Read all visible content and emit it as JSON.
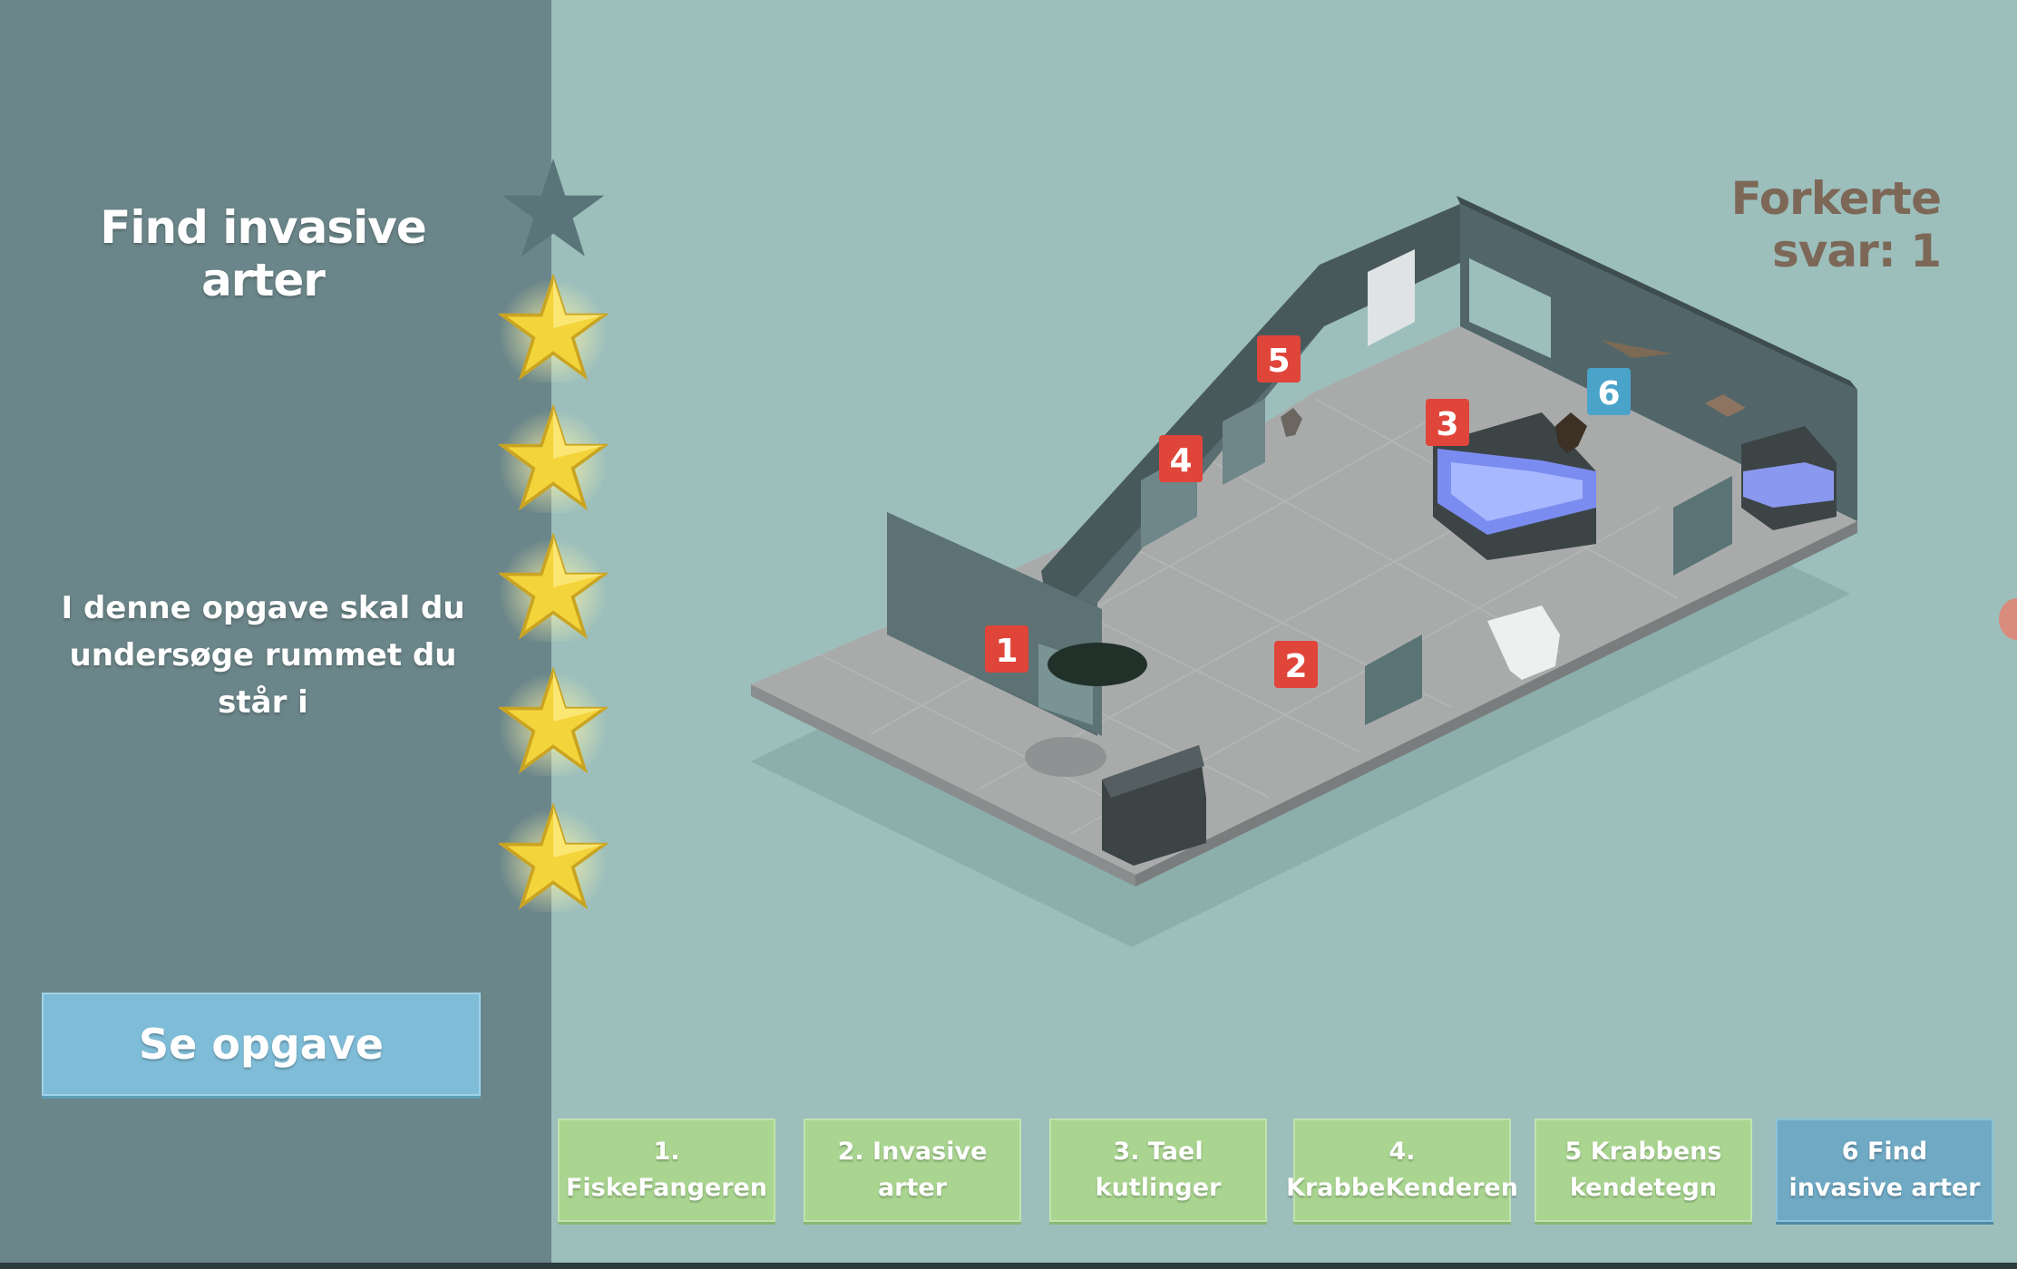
{
  "sidebar": {
    "title": "Find invasive arter",
    "description": "I denne opgave skal du undersøge rummet du står i",
    "see_task_label": "Se opgave",
    "stars": {
      "earned": 5,
      "total": 6
    }
  },
  "header": {
    "wrong_answers": "Forkerte svar: 1"
  },
  "scene": {
    "markers": [
      "1",
      "2",
      "3",
      "4",
      "5",
      "6"
    ],
    "colors": {
      "marker_red": "#e0453a",
      "marker_blue": "#4aa3c9"
    }
  },
  "tabs": [
    {
      "label": "1. FiskeFangeren"
    },
    {
      "label": "2. Invasive arter"
    },
    {
      "label": "3. Tael kutlinger"
    },
    {
      "label": "4. KrabbeKenderen"
    },
    {
      "label": "5 Krabbens kendetegn"
    },
    {
      "label": "6 Find invasive arter"
    }
  ],
  "active_tab": "6 Find invasive arter",
  "colors": {
    "background": "#9cbfbc",
    "sidebar": "#6b868a",
    "button_blue": "#7fbcd7",
    "tab_green": "#a9d590",
    "star_gold": "#f3d43a"
  }
}
